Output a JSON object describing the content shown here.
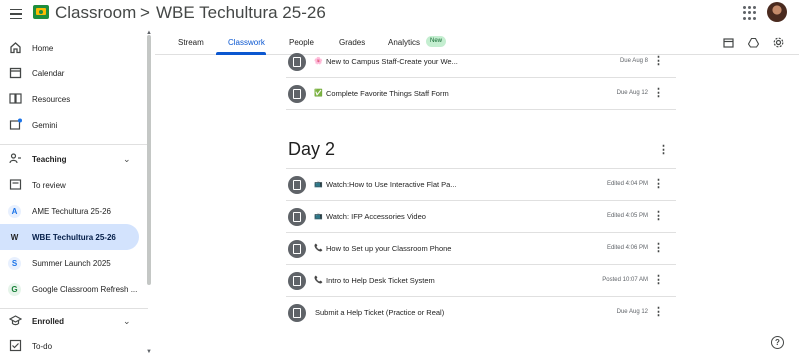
{
  "header": {
    "app_title": "Classroom",
    "separator": ">",
    "course_title": "WBE Techultura 25-26"
  },
  "sidebar": {
    "items": [
      {
        "label": "Home",
        "icon": "home-icon"
      },
      {
        "label": "Calendar",
        "icon": "calendar-icon"
      },
      {
        "label": "Resources",
        "icon": "resources-icon"
      },
      {
        "label": "Gemini",
        "icon": "gemini-icon"
      }
    ],
    "teaching": {
      "label": "Teaching",
      "chevron": "⌄"
    },
    "teaching_items": [
      {
        "label": "To review",
        "icon": "to-review-icon"
      },
      {
        "label": "AME Techultura 25-26",
        "letter": "A",
        "color": "#1a73e8",
        "bg": "#e8f0fe"
      },
      {
        "label": "WBE Techultura 25-26",
        "letter": "W",
        "color": "#1f1f1f",
        "bg": "#d3e3fd"
      },
      {
        "label": "Summer Launch 2025",
        "letter": "S",
        "color": "#1a73e8",
        "bg": "#e8f0fe"
      },
      {
        "label": "Google Classroom Refresh ...",
        "letter": "G",
        "color": "#188038",
        "bg": "#e6f4ea"
      }
    ],
    "enrolled": {
      "label": "Enrolled",
      "chevron": "⌄"
    },
    "enrolled_items": [
      {
        "label": "To-do",
        "icon": "to-do-icon"
      }
    ]
  },
  "tabs": [
    {
      "label": "Stream"
    },
    {
      "label": "Classwork"
    },
    {
      "label": "People"
    },
    {
      "label": "Grades"
    },
    {
      "label": "Analytics"
    }
  ],
  "tab_badge": "New",
  "active_tab": "Classwork",
  "toolbar_icons": [
    "calendar-icon",
    "drive-icon",
    "settings-icon"
  ],
  "section": {
    "title": "Day 2"
  },
  "items_top": [
    {
      "title": "New to Campus Staff-Create your We...",
      "meta": "Due Aug 8",
      "emoji": "🌸"
    },
    {
      "title": "Complete Favorite Things Staff Form",
      "meta": "Due Aug 12",
      "emoji": "✅"
    }
  ],
  "items_day2": [
    {
      "title": "Watch:How to Use Interactive Flat Pa...",
      "meta": "Edited 4:04 PM",
      "emoji": "📺"
    },
    {
      "title": "Watch: IFP Accessories Video",
      "meta": "Edited 4:05 PM",
      "emoji": "📺"
    },
    {
      "title": "How to Set up your Classroom Phone",
      "meta": "Edited 4:06 PM",
      "emoji": "📞"
    },
    {
      "title": "Intro to Help Desk Ticket System",
      "meta": "Posted 10:07 AM",
      "emoji": "📞"
    },
    {
      "title": "Submit a Help Ticket (Practice or Real)",
      "meta": "Due Aug 12",
      "emoji": ""
    }
  ],
  "help": "?",
  "colors": {
    "accent": "#0b57d0",
    "active_bg": "#d3e3fd",
    "badge_bg": "#c4eed0"
  }
}
